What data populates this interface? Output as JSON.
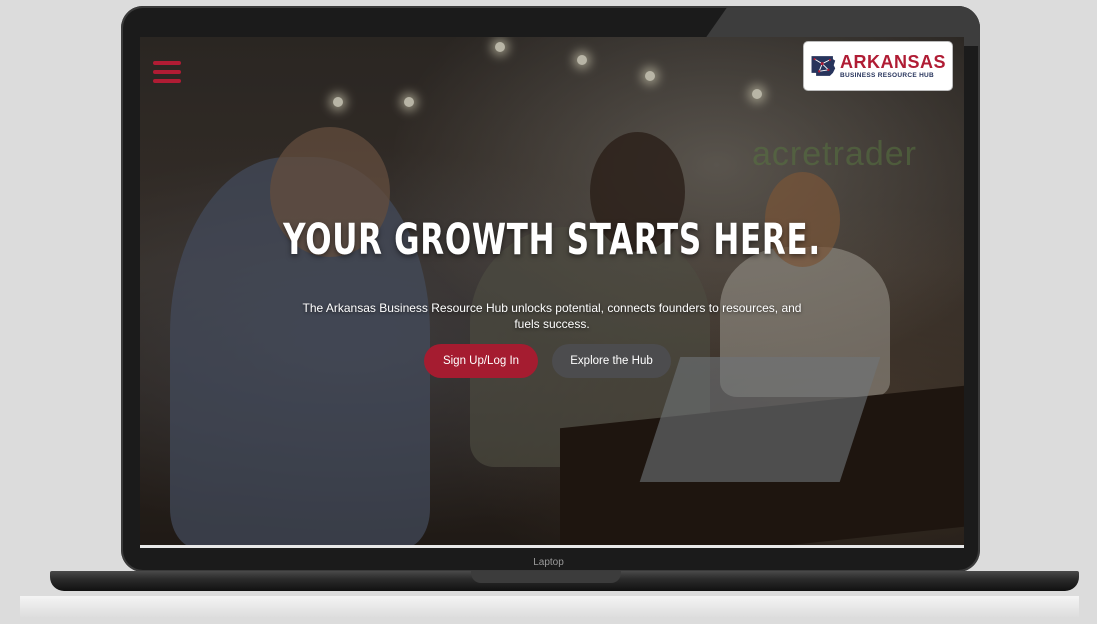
{
  "frame": {
    "base_label": "Laptop"
  },
  "site": {
    "logo": {
      "name": "ARKANSAS",
      "tagline": "BUSINESS RESOURCE HUB",
      "icon": "arkansas-state-map-icon"
    },
    "menu_icon": "hamburger-menu-icon",
    "background_sign_text": "acretrader",
    "hero": {
      "title": "YOUR GROWTH STARTS HERE.",
      "subtitle": "The Arkansas Business Resource Hub unlocks potential, connects founders to resources, and fuels success.",
      "primary_button": "Sign Up/Log In",
      "secondary_button": "Explore the Hub"
    }
  },
  "colors": {
    "brand_red": "#a51c30",
    "brand_navy": "#27345c",
    "secondary_button": "#4c4c4e"
  }
}
